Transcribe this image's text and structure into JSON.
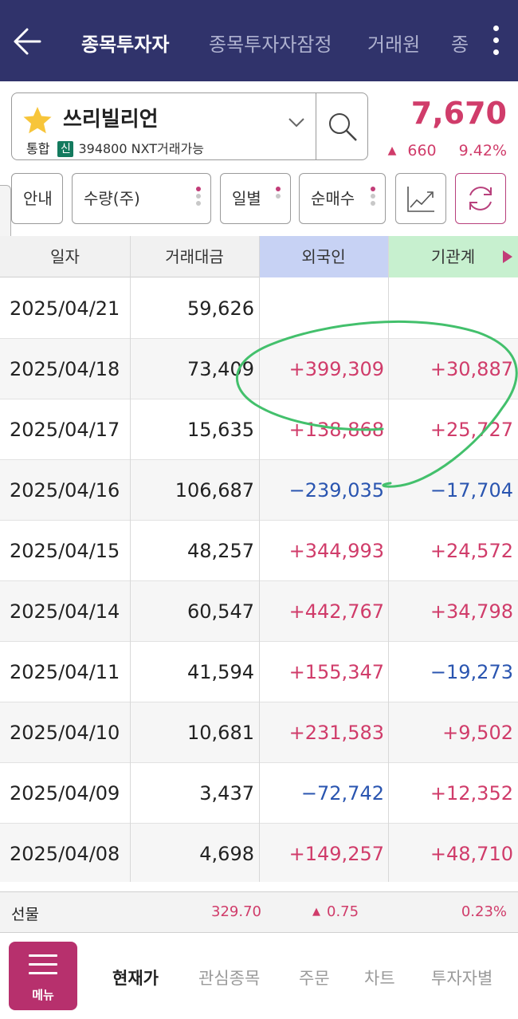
{
  "header": {
    "tabs": [
      {
        "label": "종목투자자"
      },
      {
        "label": "종목투자자잠정"
      },
      {
        "label": "거래원"
      },
      {
        "label": "종"
      }
    ]
  },
  "stock": {
    "name": "쓰리빌리언",
    "market_badge": "통합",
    "credit_badge": "신",
    "code_line": "394800 NXT거래가능",
    "price": "7,670",
    "change": "660",
    "change_pct": "9.42%",
    "direction": "up"
  },
  "filters": {
    "info_label": "안내",
    "unit_label": "수량(주)",
    "period_label": "일별",
    "type_label": "순매수"
  },
  "table": {
    "headers": [
      "일자",
      "거래대금",
      "외국인",
      "기관계"
    ],
    "rows": [
      {
        "date": "2025/04/21",
        "amount": "59,626",
        "foreign": "",
        "institution": ""
      },
      {
        "date": "2025/04/18",
        "amount": "73,409",
        "foreign": "+399,309",
        "institution": "+30,887"
      },
      {
        "date": "2025/04/17",
        "amount": "15,635",
        "foreign": "+138,868",
        "institution": "+25,727"
      },
      {
        "date": "2025/04/16",
        "amount": "106,687",
        "foreign": "−239,035",
        "institution": "−17,704"
      },
      {
        "date": "2025/04/15",
        "amount": "48,257",
        "foreign": "+344,993",
        "institution": "+24,572"
      },
      {
        "date": "2025/04/14",
        "amount": "60,547",
        "foreign": "+442,767",
        "institution": "+34,798"
      },
      {
        "date": "2025/04/11",
        "amount": "41,594",
        "foreign": "+155,347",
        "institution": "−19,273"
      },
      {
        "date": "2025/04/10",
        "amount": "10,681",
        "foreign": "+231,583",
        "institution": "+9,502"
      },
      {
        "date": "2025/04/09",
        "amount": "3,437",
        "foreign": "−72,742",
        "institution": "+12,352"
      },
      {
        "date": "2025/04/08",
        "amount": "4,698",
        "foreign": "+149,257",
        "institution": "+48,710"
      }
    ]
  },
  "futures": {
    "label": "선물",
    "value": "329.70",
    "change": "0.75",
    "change_pct": "0.23%"
  },
  "bottom_nav": {
    "menu_label": "메뉴",
    "items": [
      {
        "label": "현재가"
      },
      {
        "label": "관심종목"
      },
      {
        "label": "주문"
      },
      {
        "label": "차트"
      },
      {
        "label": "투자자별"
      }
    ]
  },
  "colors": {
    "header_bg": "#30336b",
    "up": "#d03c6a",
    "down": "#2a55b0",
    "foreign_header": "#c7d2f4",
    "institution_header": "#c7f0cf",
    "menu_bg": "#b7306d",
    "annotation": "#43c06c"
  },
  "icons": [
    "back-arrow-icon",
    "more-vert-icon",
    "star-icon",
    "chevron-down-icon",
    "search-icon",
    "chart-icon",
    "refresh-icon",
    "gear-icon",
    "arrow-right-icon",
    "menu-icon"
  ]
}
